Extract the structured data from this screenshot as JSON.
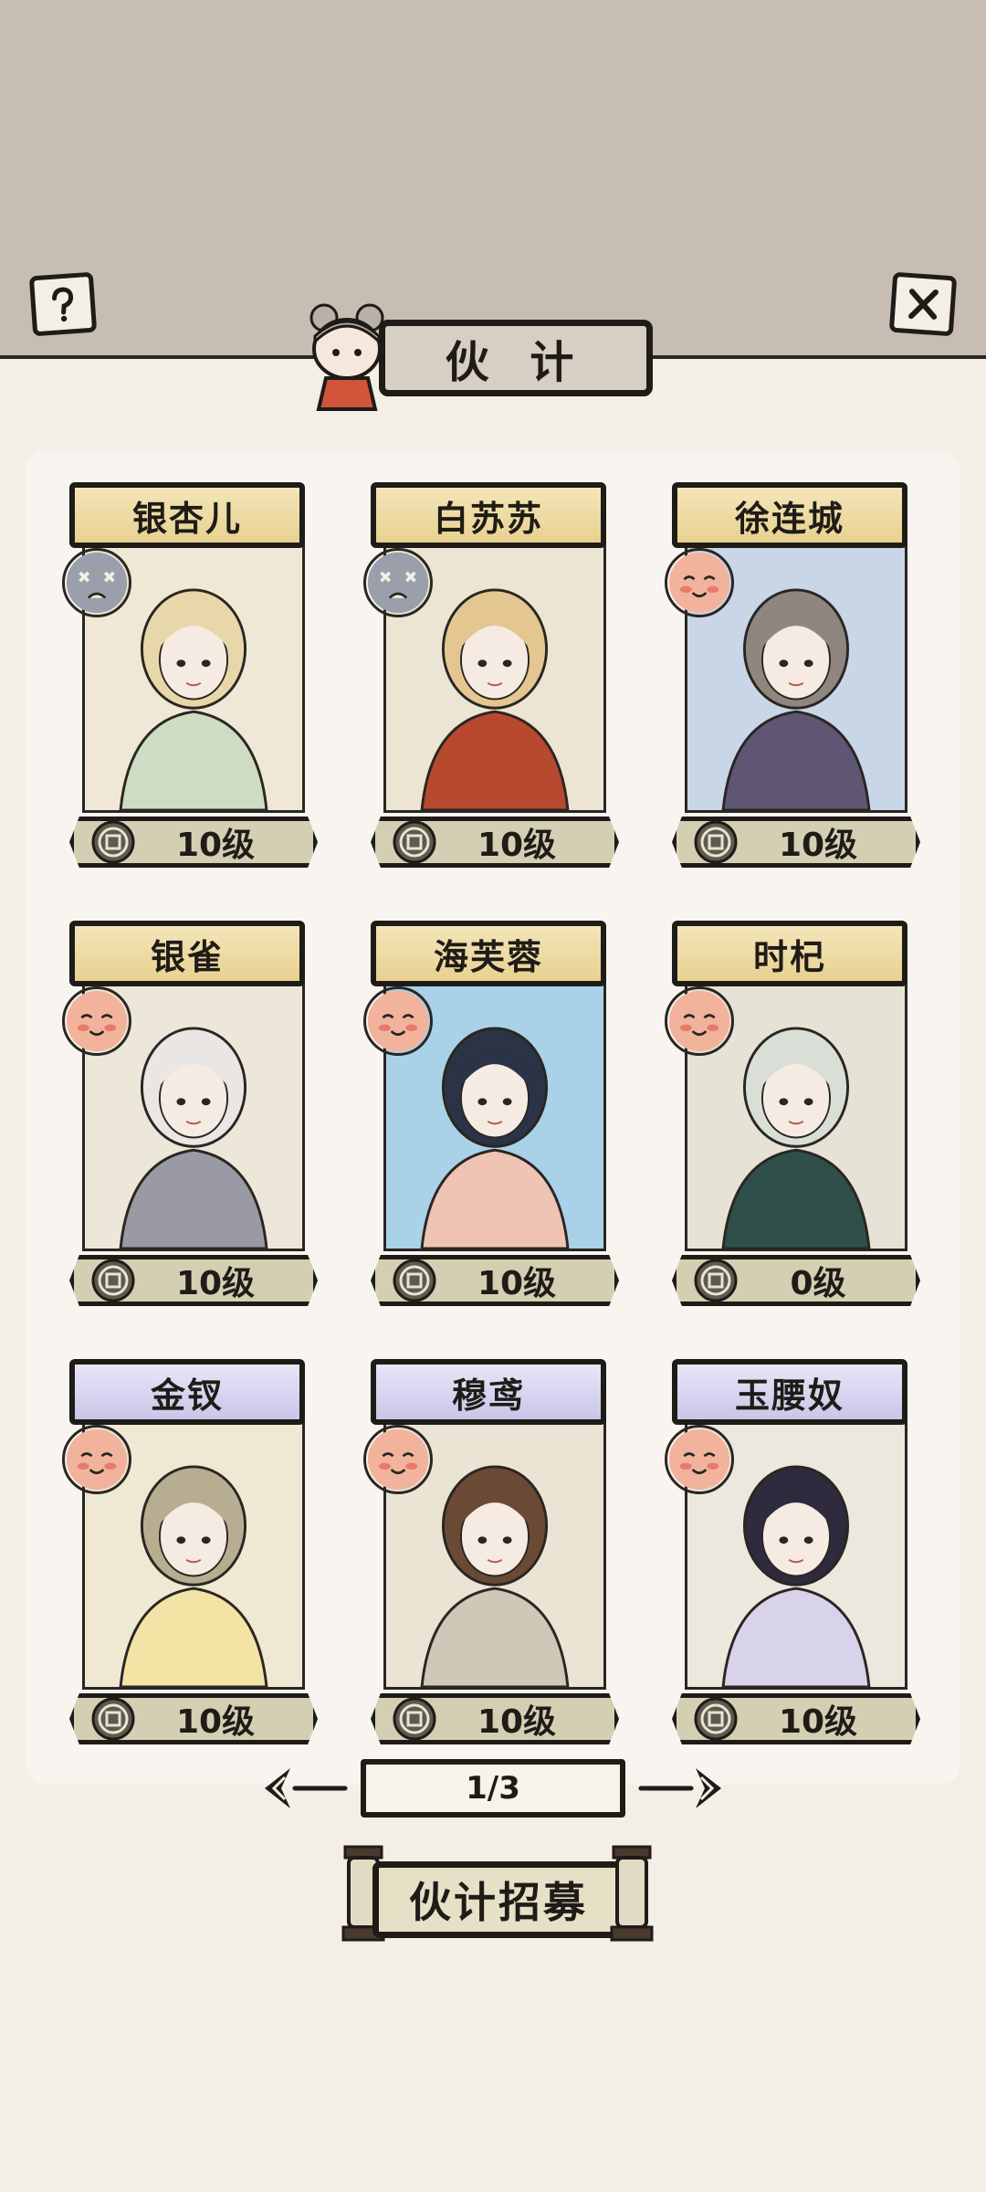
{
  "header": {
    "title": "伙 计",
    "help_icon": "question-icon",
    "close_icon": "close-icon"
  },
  "cards": [
    {
      "name": "银杏儿",
      "level": "10级",
      "banner": "gold",
      "mood": "sad",
      "art_bg": "#efe8d6",
      "hair": "#e8d7a8",
      "cloth": "#cfdcc4"
    },
    {
      "name": "白苏苏",
      "level": "10级",
      "banner": "gold",
      "mood": "sad",
      "art_bg": "#ece5d3",
      "hair": "#e4c790",
      "cloth": "#b7492f"
    },
    {
      "name": "徐连城",
      "level": "10级",
      "banner": "gold",
      "mood": "happy",
      "art_bg": "#c8d6e8",
      "hair": "#8f877f",
      "cloth": "#5f5674"
    },
    {
      "name": "银雀",
      "level": "10级",
      "banner": "gold",
      "mood": "happy",
      "art_bg": "#ede7d9",
      "hair": "#e9e6e3",
      "cloth": "#9a9aa4"
    },
    {
      "name": "海芙蓉",
      "level": "10级",
      "banner": "gold",
      "mood": "happy",
      "art_bg": "#a9d2e8",
      "hair": "#2b3346",
      "cloth": "#f0c4b4"
    },
    {
      "name": "时杞",
      "level": "0级",
      "banner": "gold",
      "mood": "happy",
      "art_bg": "#e6e2d6",
      "hair": "#d9dfd6",
      "cloth": "#2f4f4a"
    },
    {
      "name": "金钗",
      "level": "10级",
      "banner": "purple",
      "mood": "happy",
      "art_bg": "#efe8d3",
      "hair": "#b7ae92",
      "cloth": "#f3e3a4"
    },
    {
      "name": "穆鸢",
      "level": "10级",
      "banner": "purple",
      "mood": "happy",
      "art_bg": "#ebe4d4",
      "hair": "#6b4a35",
      "cloth": "#cfc7b8"
    },
    {
      "name": "玉腰奴",
      "level": "10级",
      "banner": "purple",
      "mood": "happy",
      "art_bg": "#ede8de",
      "hair": "#2d2b3d",
      "cloth": "#d8d3ea"
    }
  ],
  "pager": {
    "label": "1/3"
  },
  "recruit": {
    "label": "伙计招募"
  },
  "colors": {
    "gold_banner": "#e8d190",
    "purple_banner": "#c9c6e8",
    "level_bar": "#d4cfb3",
    "panel": "#f8f5f0"
  }
}
